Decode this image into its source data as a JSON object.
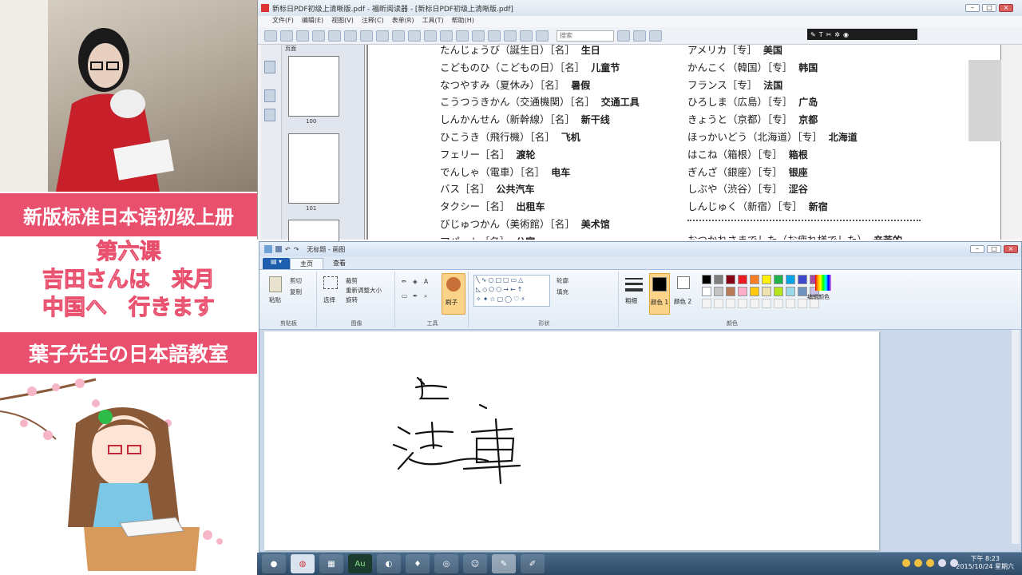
{
  "overlay": {
    "series_title": "新版标准日本语初级上册",
    "lesson_line1": "第六课",
    "lesson_line2": "吉田さんは　来月",
    "lesson_line3": "中国へ　行きます",
    "teacher": "葉子先生の日本語教室"
  },
  "pdf_window": {
    "title": "新标日PDF初级上清晰版.pdf - 福昕阅读器 - [新标日PDF初级上清晰版.pdf]",
    "menu": [
      "文件(F)",
      "编辑(E)",
      "视图(V)",
      "注释(C)",
      "表单(R)",
      "工具(T)",
      "帮助(H)"
    ],
    "search_placeholder": "搜索",
    "sidebar_header": "页面",
    "thumb_pages": [
      "100",
      "101"
    ],
    "vocab_left": [
      {
        "kana": "たんじょうび（誕生日）［名］",
        "cn": "生日"
      },
      {
        "kana": "こどものひ（こどもの日）［名］",
        "cn": "儿童节"
      },
      {
        "kana": "なつやすみ（夏休み）［名］",
        "cn": "暑假"
      },
      {
        "kana": "こうつうきかん（交通機関）［名］",
        "cn": "交通工具"
      },
      {
        "kana": "しんかんせん（新幹線）［名］",
        "cn": "新干线"
      },
      {
        "kana": "ひこうき（飛行機）［名］",
        "cn": "飞机"
      },
      {
        "kana": "フェリー［名］",
        "cn": "渡轮"
      },
      {
        "kana": "でんしゃ（電車）［名］",
        "cn": "电车"
      },
      {
        "kana": "バス［名］",
        "cn": "公共汽车"
      },
      {
        "kana": "タクシー［名］",
        "cn": "出租车"
      },
      {
        "kana": "びじゅつかん（美術館）［名］",
        "cn": "美术馆"
      },
      {
        "kana": "アパート［名］",
        "cn": "公寓"
      }
    ],
    "vocab_right": [
      {
        "kana": "アメリカ［专］",
        "cn": "美国"
      },
      {
        "kana": "かんこく（韓国）［专］",
        "cn": "韩国"
      },
      {
        "kana": "フランス［专］",
        "cn": "法国"
      },
      {
        "kana": "ひろしま（広島）［专］",
        "cn": "广岛"
      },
      {
        "kana": "きょうと（京都）［专］",
        "cn": "京都"
      },
      {
        "kana": "ほっかいどう（北海道）［专］",
        "cn": "北海道"
      },
      {
        "kana": "はこね（箱根）［专］",
        "cn": "箱根"
      },
      {
        "kana": "ぎんざ（銀座）［专］",
        "cn": "银座"
      },
      {
        "kana": "しぶや（渋谷）［专］",
        "cn": "涩谷"
      },
      {
        "kana": "しんじゅく（新宿）［专］",
        "cn": "新宿"
      },
      {
        "kana": "おつかれさまでした（お疲れ様でした）",
        "cn": "辛苦的"
      }
    ]
  },
  "paint_window": {
    "title": "无标题 - 画图",
    "tabs": [
      "主页",
      "查看"
    ],
    "groups": {
      "clipboard": "剪贴板",
      "image": "图像",
      "tools": "工具",
      "shapes": "形状",
      "colors": "颜色"
    },
    "buttons": {
      "paste": "粘贴",
      "cut": "剪切",
      "copy": "复制",
      "select": "选择",
      "crop": "裁剪",
      "resize": "重新调整大小",
      "rotate": "旋转",
      "brushes": "刷子",
      "outline": "轮廓",
      "fill": "填充",
      "size": "粗细",
      "color1": "颜色 1",
      "color2": "颜色 2",
      "edit_colors": "编辑颜色"
    },
    "palette": [
      "#000000",
      "#7f7f7f",
      "#880015",
      "#ed1c24",
      "#ff7f27",
      "#fff200",
      "#22b14c",
      "#00a2e8",
      "#3f48cc",
      "#a349a4",
      "#ffffff",
      "#c3c3c3",
      "#b97a57",
      "#ffaec9",
      "#ffc90e",
      "#efe4b0",
      "#b5e61d",
      "#99d9ea",
      "#7092be",
      "#c8bfe7"
    ],
    "color1": "#000000",
    "color2": "#ffffff"
  },
  "taskbar": {
    "clock_time": "下午 8:23",
    "clock_date": "2015/10/24 星期六",
    "apps": [
      "media",
      "app",
      "folder",
      "audition",
      "browser",
      "chat",
      "disk",
      "anime",
      "paint",
      "tool"
    ],
    "app_labels": [
      "Au"
    ]
  }
}
